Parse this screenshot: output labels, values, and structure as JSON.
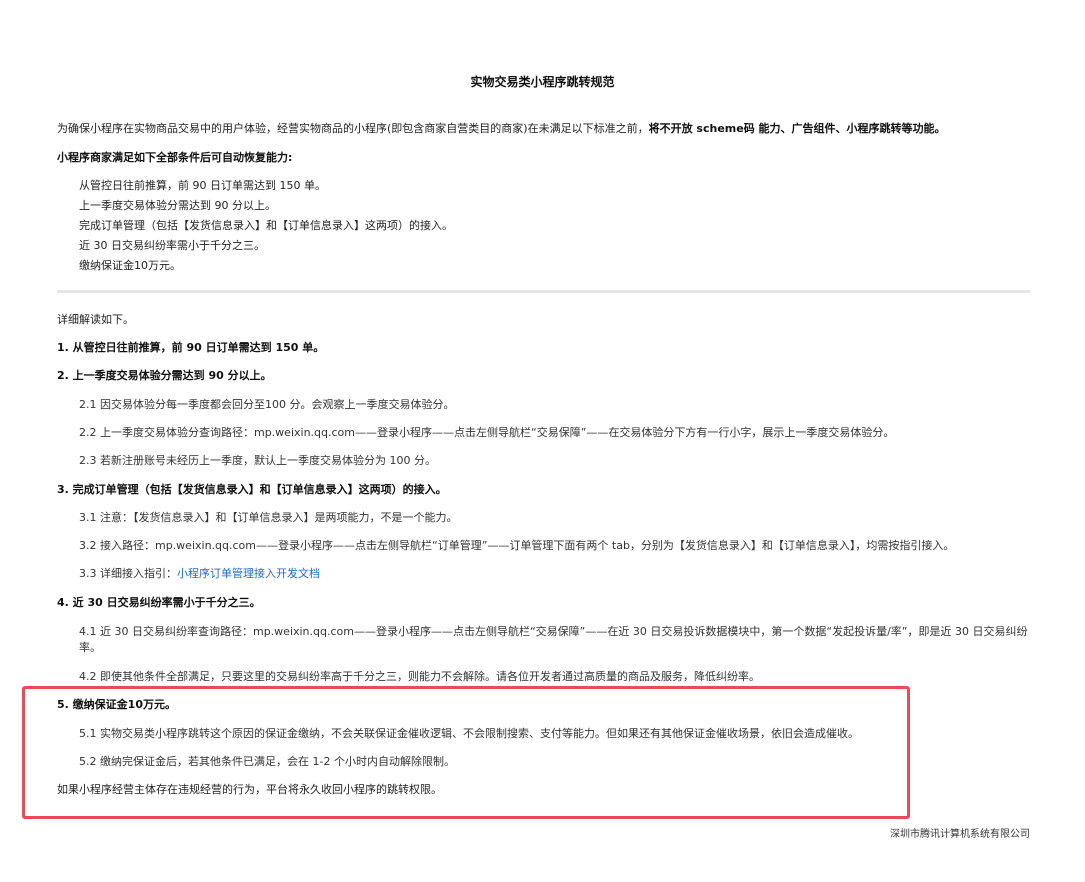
{
  "doc": {
    "title": "实物交易类小程序跳转规范",
    "intro_normal": "为确保小程序在实物商品交易中的用户体验，经营实物商品的小程序(即包含商家自营类目的商家)在未满足以下标准之前，",
    "intro_bold": "将不开放 scheme码 能力、广告组件、小程序跳转等功能。",
    "conditions_heading": "小程序商家满足如下全部条件后可自动恢复能力:",
    "conditions": [
      "从管控日往前推算，前 90 日订单需达到 150 单。",
      "上一季度交易体验分需达到 90 分以上。",
      "完成订单管理（包括【发货信息录入】和【订单信息录入】这两项）的接入。",
      "近 30 日交易纠纷率需小于千分之三。",
      "缴纳保证金10万元。"
    ],
    "detail_intro": "详细解读如下。",
    "s1_heading": "1. 从管控日往前推算，前 90 日订单需达到 150 单。",
    "s2_heading": "2. 上一季度交易体验分需达到 90 分以上。",
    "s2_1": "2.1 因交易体验分每一季度都会回分至100 分。会观察上一季度交易体验分。",
    "s2_2": "2.2 上一季度交易体验分查询路径：mp.weixin.qq.com——登录小程序——点击左侧导航栏“交易保障”——在交易体验分下方有一行小字，展示上一季度交易体验分。",
    "s2_3": "2.3 若新注册账号未经历上一季度，默认上一季度交易体验分为 100 分。",
    "s3_heading": "3. 完成订单管理（包括【发货信息录入】和【订单信息录入】这两项）的接入。",
    "s3_1": "3.1 注意：【发货信息录入】和【订单信息录入】是两项能力，不是一个能力。",
    "s3_2": "3.2 接入路径：mp.weixin.qq.com——登录小程序——点击左侧导航栏“订单管理”——订单管理下面有两个 tab，分别为【发货信息录入】和【订单信息录入】，均需按指引接入。",
    "s3_3_prefix": "3.3 详细接入指引：",
    "s3_3_link": "小程序订单管理接入开发文档",
    "s4_heading": "4. 近 30 日交易纠纷率需小于千分之三。",
    "s4_1": "4.1 近 30 日交易纠纷率查询路径：mp.weixin.qq.com——登录小程序——点击左侧导航栏“交易保障”——在近 30 日交易投诉数据模块中，第一个数据“发起投诉量/率”，即是近 30 日交易纠纷率。",
    "s4_2": "4.2 即使其他条件全部满足，只要这里的交易纠纷率高于千分之三，则能力不会解除。请各位开发者通过高质量的商品及服务，降低纠纷率。",
    "s5_heading": "5. 缴纳保证金10万元。",
    "s5_1": "5.1 实物交易类小程序跳转这个原因的保证金缴纳，不会关联保证金催收逻辑、不会限制搜索、支付等能力。但如果还有其他保证金催收场景，依旧会造成催收。",
    "s5_2": "5.2 缴纳完保证金后，若其他条件已满足，会在 1-2 个小时内自动解除限制。",
    "closing": "如果小程序经营主体存在违规经营的行为，平台将永久收回小程序的跳转权限。",
    "footer": "深圳市腾讯计算机系统有限公司"
  },
  "colors": {
    "highlight_border": "#e94b57",
    "link": "#1b6bd8",
    "divider": "#e6e6e6"
  }
}
